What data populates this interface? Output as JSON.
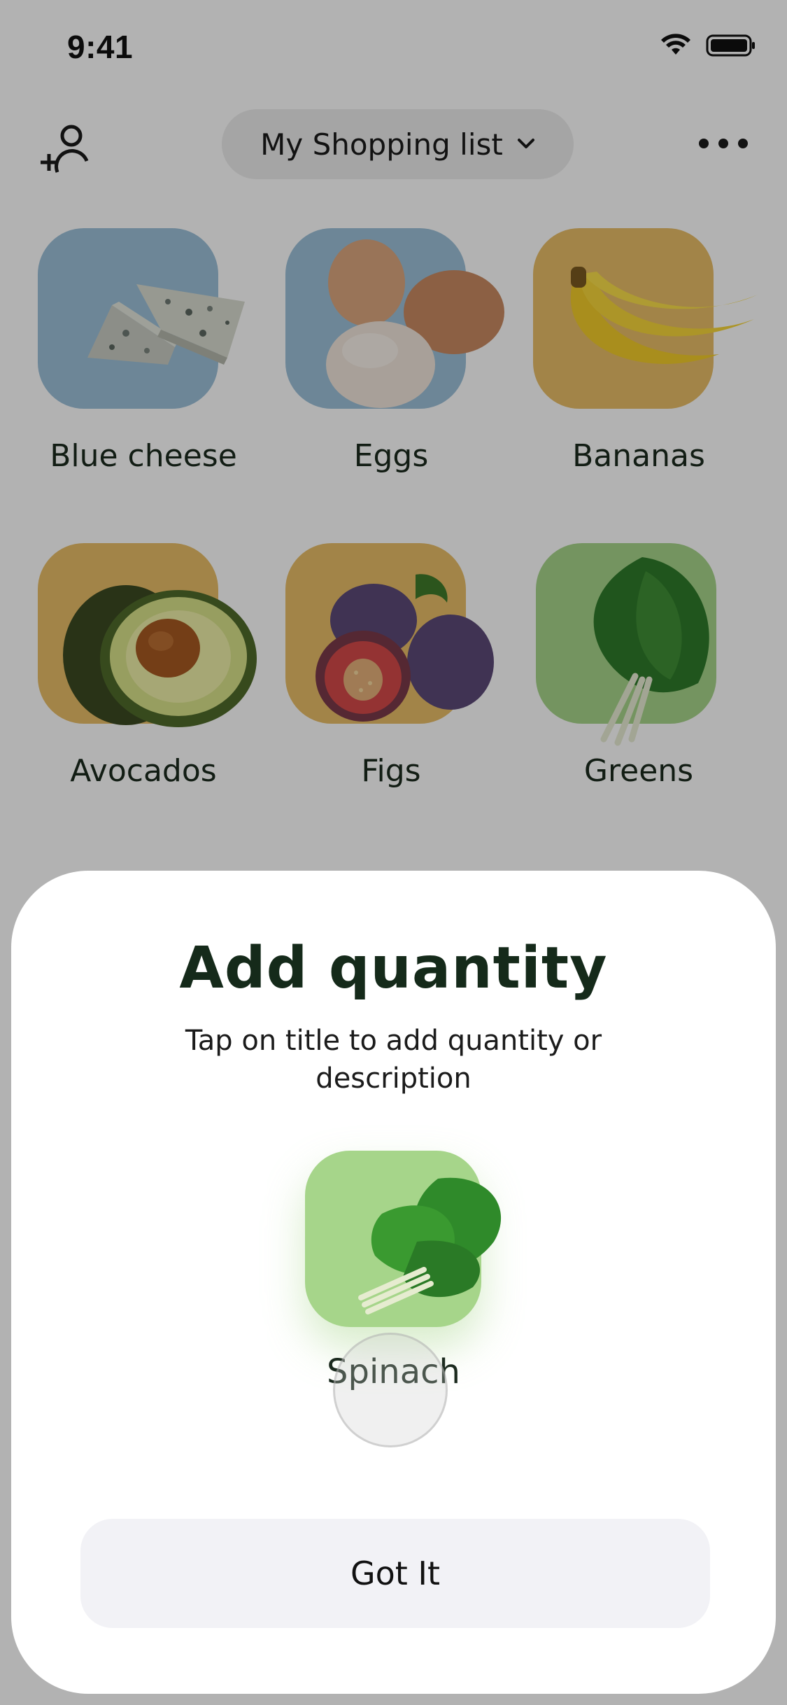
{
  "status_bar": {
    "time": "9:41"
  },
  "header": {
    "list_title": "My Shopping list",
    "add_user_icon": "add-user-icon",
    "more_icon": "more-icon"
  },
  "items": [
    {
      "label": "Blue cheese",
      "tile_color": "#9cc1d9"
    },
    {
      "label": "Eggs",
      "tile_color": "#9cc1d9"
    },
    {
      "label": "Bananas",
      "tile_color": "#e8bd67"
    },
    {
      "label": "Avocados",
      "tile_color": "#e8bd67"
    },
    {
      "label": "Figs",
      "tile_color": "#e8bd67"
    },
    {
      "label": "Greens",
      "tile_color": "#a6d58a"
    }
  ],
  "sheet": {
    "title": "Add quantity",
    "subtitle": "Tap on title to add quantity or description",
    "item_label": "Spinach",
    "item_tile_color": "#a6d58a",
    "button_label": "Got It"
  },
  "colors": {
    "overlay": "rgba(0,0,0,0.30)",
    "text_dark": "#1b2a1e",
    "button_bg": "#f2f2f6"
  }
}
